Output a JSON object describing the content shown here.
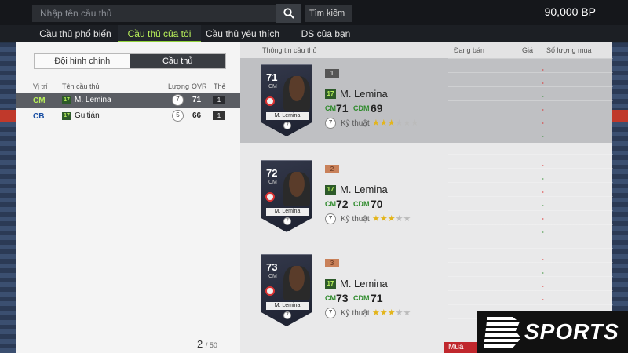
{
  "search": {
    "placeholder": "Nhập tên cầu thủ",
    "filter_label": "Tìm kiếm"
  },
  "balance": "90,000 BP",
  "tabs": [
    {
      "label": "Cầu thủ phổ biến"
    },
    {
      "label": "Cầu thủ của tôi",
      "active": true
    },
    {
      "label": "Cầu thủ yêu thích"
    },
    {
      "label": "DS của bạn"
    }
  ],
  "left": {
    "segments": [
      "Đội hình chính",
      "Cầu thủ"
    ],
    "headers": {
      "pos": "Vị trí",
      "name": "Tên cầu thủ",
      "qty": "Lượng",
      "ovr": "OVR",
      "card": "Thẻ"
    },
    "rows": [
      {
        "pos": "CM",
        "season": "17",
        "name": "M. Lemina",
        "qty": "7",
        "ovr": "71",
        "card": "1"
      },
      {
        "pos": "CB",
        "season": "17",
        "name": "Guitián",
        "qty": "5",
        "ovr": "66",
        "card": "1"
      }
    ],
    "pager": {
      "current": "2",
      "total": "/ 50"
    }
  },
  "right": {
    "headers": {
      "info": "Thông tin cầu thủ",
      "selling": "Đang bán",
      "price": "Giá",
      "buy_qty": "Số lượng mua"
    },
    "cards": [
      {
        "rank": "1",
        "ovr": "71",
        "pos": "CM",
        "season": "17",
        "name": "M. Lemina",
        "card_name": "M. Lemina",
        "pos1": "CM",
        "val1": "71",
        "pos2": "CDM",
        "val2": "69",
        "skill_label": "Kỹ thuật",
        "skill_stars": 3,
        "skill_max": 6,
        "seal": "7"
      },
      {
        "rank": "2",
        "ovr": "72",
        "pos": "CM",
        "season": "17",
        "name": "M. Lemina",
        "card_name": "M. Lemina",
        "pos1": "CM",
        "val1": "72",
        "pos2": "CDM",
        "val2": "70",
        "skill_label": "Kỹ thuật",
        "skill_stars": 3,
        "skill_max": 5,
        "seal": "7"
      },
      {
        "rank": "3",
        "ovr": "73",
        "pos": "CM",
        "season": "17",
        "name": "M. Lemina",
        "card_name": "M. Lemina",
        "pos1": "CM",
        "val1": "73",
        "pos2": "CDM",
        "val2": "71",
        "skill_label": "Kỹ thuật",
        "skill_stars": 3,
        "skill_max": 5,
        "seal": "7"
      }
    ],
    "dash": "-"
  },
  "buy_button": "Mua",
  "logo_text": "SPORTS",
  "colors": {
    "accent": "#8fd13a",
    "buy": "#c0272d",
    "selected_row": "#5a5d63"
  }
}
